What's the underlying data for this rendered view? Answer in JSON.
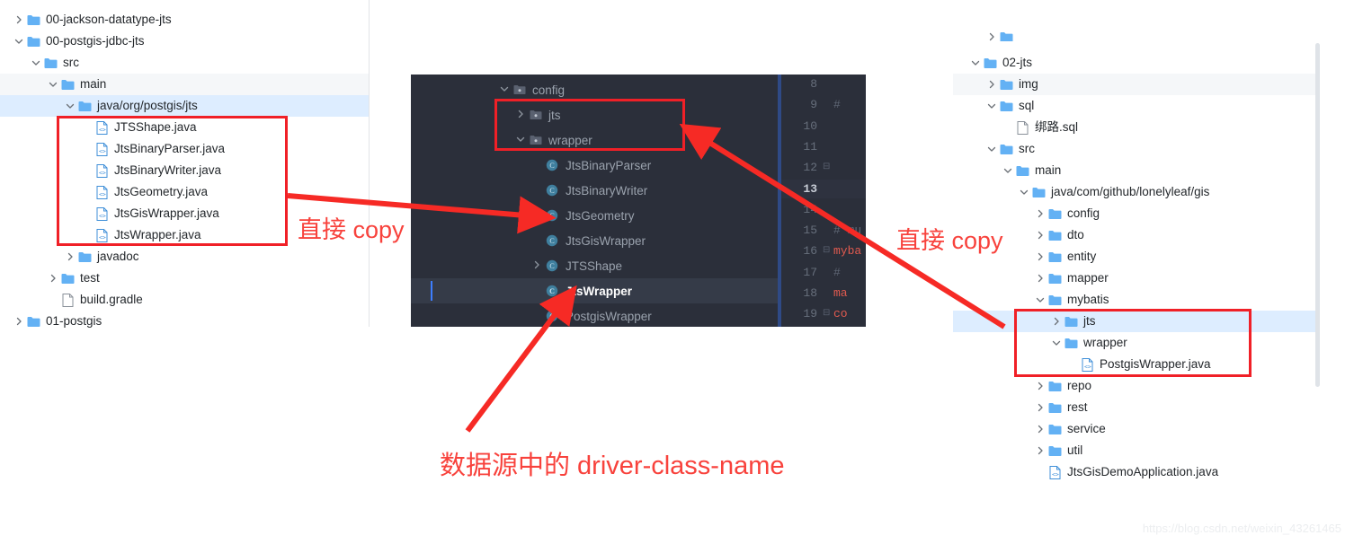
{
  "left_tree": {
    "rows": [
      {
        "label": "00-jackson-datatype-jts",
        "indent": 0,
        "arrow": "right",
        "icon": "folder",
        "state": "none"
      },
      {
        "label": "00-postgis-jdbc-jts",
        "indent": 0,
        "arrow": "down",
        "icon": "folder",
        "state": "none"
      },
      {
        "label": "src",
        "indent": 1,
        "arrow": "down",
        "icon": "folder",
        "state": "none"
      },
      {
        "label": "main",
        "indent": 2,
        "arrow": "down",
        "icon": "folder",
        "state": "hover"
      },
      {
        "label": "java/org/postgis/jts",
        "indent": 3,
        "arrow": "down",
        "icon": "folder",
        "state": "selected"
      },
      {
        "label": "JTSShape.java",
        "indent": 4,
        "arrow": "none",
        "icon": "java-file",
        "state": "none"
      },
      {
        "label": "JtsBinaryParser.java",
        "indent": 4,
        "arrow": "none",
        "icon": "java-file",
        "state": "none"
      },
      {
        "label": "JtsBinaryWriter.java",
        "indent": 4,
        "arrow": "none",
        "icon": "java-file",
        "state": "none"
      },
      {
        "label": "JtsGeometry.java",
        "indent": 4,
        "arrow": "none",
        "icon": "java-file",
        "state": "none"
      },
      {
        "label": "JtsGisWrapper.java",
        "indent": 4,
        "arrow": "none",
        "icon": "java-file",
        "state": "none"
      },
      {
        "label": "JtsWrapper.java",
        "indent": 4,
        "arrow": "none",
        "icon": "java-file",
        "state": "none"
      },
      {
        "label": "javadoc",
        "indent": 3,
        "arrow": "right",
        "icon": "folder",
        "state": "none"
      },
      {
        "label": "test",
        "indent": 2,
        "arrow": "right",
        "icon": "folder",
        "state": "none"
      },
      {
        "label": "build.gradle",
        "indent": 2,
        "arrow": "none",
        "icon": "plain-file",
        "state": "none"
      },
      {
        "label": "01-postgis",
        "indent": 0,
        "arrow": "right",
        "icon": "folder",
        "state": "none"
      }
    ]
  },
  "dark_tree": {
    "rows": [
      {
        "label": "config",
        "indent": 0,
        "arrow": "down",
        "icon": "package",
        "state": "none"
      },
      {
        "label": "jts",
        "indent": 1,
        "arrow": "right",
        "icon": "package",
        "state": "none"
      },
      {
        "label": "wrapper",
        "indent": 1,
        "arrow": "down",
        "icon": "package",
        "state": "none"
      },
      {
        "label": "JtsBinaryParser",
        "indent": 2,
        "arrow": "none",
        "icon": "class",
        "state": "none"
      },
      {
        "label": "JtsBinaryWriter",
        "indent": 2,
        "arrow": "none",
        "icon": "class",
        "state": "none"
      },
      {
        "label": "JtsGeometry",
        "indent": 2,
        "arrow": "none",
        "icon": "class",
        "state": "none"
      },
      {
        "label": "JtsGisWrapper",
        "indent": 2,
        "arrow": "none",
        "icon": "class",
        "state": "none"
      },
      {
        "label": "JTSShape",
        "indent": 2,
        "arrow": "right",
        "icon": "class",
        "state": "none"
      },
      {
        "label": "JtsWrapper",
        "indent": 2,
        "arrow": "none",
        "icon": "class",
        "state": "selected"
      },
      {
        "label": "PostgisWrapper",
        "indent": 2,
        "arrow": "none",
        "icon": "class",
        "state": "none"
      }
    ]
  },
  "editor_gutter": {
    "line_numbers": [
      "8",
      "9",
      "10",
      "11",
      "12",
      "13",
      "14",
      "15",
      "16",
      "17",
      "18",
      "19"
    ],
    "current_line": "13",
    "code_fragments": [
      {
        "line": "9",
        "text": "#",
        "kind": "comment"
      },
      {
        "line": "15",
        "text": "# mu",
        "kind": "comment"
      },
      {
        "line": "16",
        "text": "myba",
        "kind": "keyword"
      },
      {
        "line": "17",
        "text": "#",
        "kind": "comment"
      },
      {
        "line": "18",
        "text": "ma",
        "kind": "keyword"
      },
      {
        "line": "19",
        "text": "co",
        "kind": "keyword"
      }
    ]
  },
  "right_tree": {
    "rows": [
      {
        "label": "02-jts",
        "indent": 0,
        "arrow": "down",
        "icon": "folder",
        "state": "none"
      },
      {
        "label": "img",
        "indent": 1,
        "arrow": "right",
        "icon": "folder",
        "state": "hover"
      },
      {
        "label": "sql",
        "indent": 1,
        "arrow": "down",
        "icon": "folder",
        "state": "none"
      },
      {
        "label": "绑路.sql",
        "indent": 2,
        "arrow": "none",
        "icon": "plain-file",
        "state": "none"
      },
      {
        "label": "src",
        "indent": 1,
        "arrow": "down",
        "icon": "folder",
        "state": "none"
      },
      {
        "label": "main",
        "indent": 2,
        "arrow": "down",
        "icon": "folder",
        "state": "none"
      },
      {
        "label": "java/com/github/lonelyleaf/gis",
        "indent": 3,
        "arrow": "down",
        "icon": "folder",
        "state": "none"
      },
      {
        "label": "config",
        "indent": 4,
        "arrow": "right",
        "icon": "folder",
        "state": "none"
      },
      {
        "label": "dto",
        "indent": 4,
        "arrow": "right",
        "icon": "folder",
        "state": "none"
      },
      {
        "label": "entity",
        "indent": 4,
        "arrow": "right",
        "icon": "folder",
        "state": "none"
      },
      {
        "label": "mapper",
        "indent": 4,
        "arrow": "right",
        "icon": "folder",
        "state": "none"
      },
      {
        "label": "mybatis",
        "indent": 4,
        "arrow": "down",
        "icon": "folder",
        "state": "none"
      },
      {
        "label": "jts",
        "indent": 5,
        "arrow": "right",
        "icon": "folder",
        "state": "selected"
      },
      {
        "label": "wrapper",
        "indent": 5,
        "arrow": "down",
        "icon": "folder",
        "state": "none"
      },
      {
        "label": "PostgisWrapper.java",
        "indent": 6,
        "arrow": "none",
        "icon": "java-file",
        "state": "none"
      },
      {
        "label": "repo",
        "indent": 4,
        "arrow": "right",
        "icon": "folder",
        "state": "none"
      },
      {
        "label": "rest",
        "indent": 4,
        "arrow": "right",
        "icon": "folder",
        "state": "none"
      },
      {
        "label": "service",
        "indent": 4,
        "arrow": "right",
        "icon": "folder",
        "state": "none"
      },
      {
        "label": "util",
        "indent": 4,
        "arrow": "right",
        "icon": "folder",
        "state": "none"
      },
      {
        "label": "JtsGisDemoApplication.java",
        "indent": 4,
        "arrow": "none",
        "icon": "java-file",
        "state": "none"
      }
    ]
  },
  "annotations": {
    "copy_left": "直接 copy",
    "copy_right": "直接 copy",
    "driver_class": "数据源中的 driver-class-name",
    "accent_color": "#f8423c",
    "box_color": "#f02027"
  },
  "watermark": {
    "text": "https://blog.csdn.net/weixin_43261465"
  }
}
